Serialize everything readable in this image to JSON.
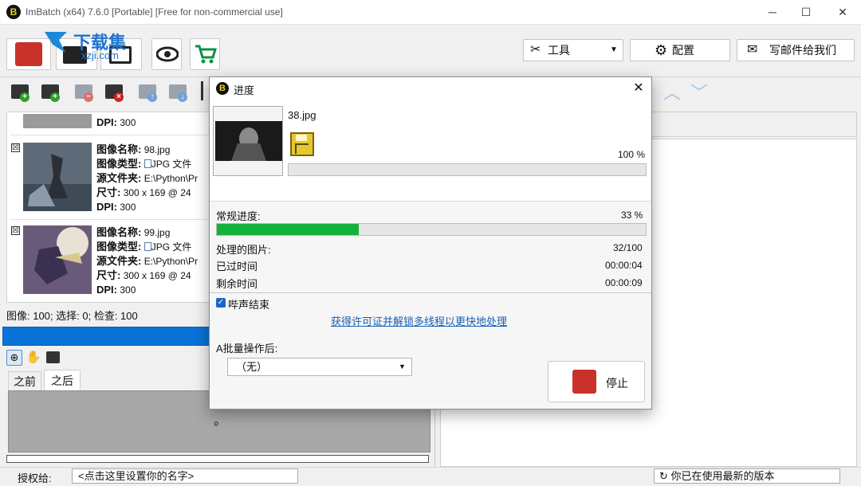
{
  "window": {
    "title": "ImBatch (x64) 7.6.0 [Portable] [Free for non-commercial use]",
    "app_icon_letter": "B",
    "controls": {
      "minimize": "─",
      "maximize": "☐",
      "close": "✕"
    }
  },
  "watermark": {
    "text": "下载集",
    "subtext": "xzji.com"
  },
  "toolbar": {
    "tools_label": "工具",
    "config_label": "配置",
    "email_label": "写邮件给我们"
  },
  "left_list": {
    "top_item": {
      "dpi_label": "DPI:",
      "dpi": "300"
    },
    "items": [
      {
        "check": "☒",
        "name_label": "图像名称:",
        "name": "98.jpg",
        "type_label": "图像类型:",
        "type": "JPG 文件",
        "src_label": "源文件夹:",
        "src": "E:\\Python\\Pr",
        "size_label": "尺寸:",
        "size": "300 x 169 @ 24",
        "dpi_label": "DPI:",
        "dpi": "300"
      },
      {
        "check": "☒",
        "name_label": "图像名称:",
        "name": "99.jpg",
        "type_label": "图像类型:",
        "type": "JPG 文件",
        "src_label": "源文件夹:",
        "src": "E:\\Python\\Pr",
        "size_label": "尺寸:",
        "size": "300 x 169 @ 24",
        "dpi_label": "DPI:",
        "dpi": "300"
      }
    ]
  },
  "status": {
    "summary": "图像: 100; 选择: 0; 检查: 100"
  },
  "preview": {
    "tab_before": "之前",
    "tab_after": "之后",
    "dot": "。"
  },
  "bottom": {
    "license_label": "授权给:",
    "name_placeholder": "<点击这里设置你的名字>",
    "version_status": "你已在使用最新的版本"
  },
  "dialog": {
    "title": "进度",
    "current_file": "38.jpg",
    "file_percent": "100 %",
    "file_progress": 1.0,
    "general_label": "常规进度:",
    "general_percent": "33 %",
    "general_progress": 0.33,
    "processed_label": "处理的图片:",
    "processed_value": "32/100",
    "elapsed_label": "已过时间",
    "elapsed_value": "00:00:04",
    "remaining_label": "剩余时间",
    "remaining_value": "00:00:09",
    "beep_label": "哔声结束",
    "beep_checked": true,
    "unlock_link": "获得许可证并解锁多线程以更快地处理",
    "after_label": "A批量操作后:",
    "after_select": "（无）",
    "stop_label": "停止"
  },
  "colors": {
    "progress_green": "#13b23b",
    "left_progress_blue": "#0a73d8",
    "stop_red": "#c8322a",
    "link_blue": "#1a5fb4"
  }
}
